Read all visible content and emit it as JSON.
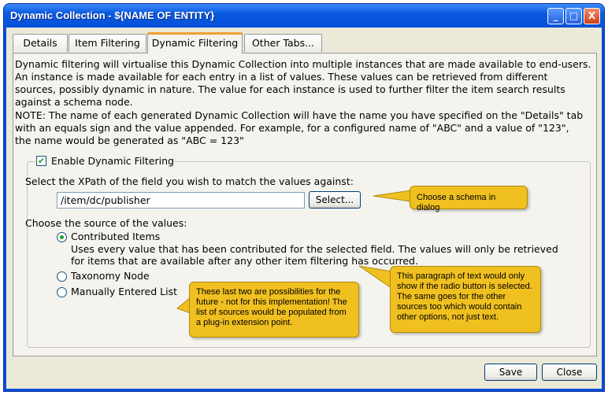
{
  "window": {
    "title": "Dynamic Collection - ${NAME OF ENTITY}",
    "minimize": "_",
    "maximize": "□",
    "close": "X"
  },
  "tabs": [
    {
      "label": "Details"
    },
    {
      "label": "Item Filtering"
    },
    {
      "label": "Dynamic Filtering"
    },
    {
      "label": "Other Tabs..."
    }
  ],
  "intro": [
    "Dynamic filtering will virtualise this Dynamic Collection into multiple instances that are made available to end-users.",
    "An instance is made available for each entry in a list of values.   These values can be retrieved from different",
    "sources, possibly dynamic in nature.  The value for each instance is used to further filter the item search results",
    "against a schema node."
  ],
  "note": [
    "NOTE: The name of each generated Dynamic Collection will have the name you have specified on the \"Details\" tab",
    "with an equals sign and the value appended.  For example, for a configured name of \"ABC\" and a value of \"123\",",
    "the name would be generated as \"ABC = 123\""
  ],
  "enable": {
    "label": "Enable Dynamic Filtering",
    "checked": true,
    "check": "✔"
  },
  "xpath": {
    "label": "Select the XPath of the field you wish to match the values against:",
    "value": "/item/dc/publisher",
    "button": "Select..."
  },
  "source": {
    "label": "Choose the source of the values:",
    "options": [
      {
        "label": "Contributed Items",
        "selected": true
      },
      {
        "label": "Taxonomy Node",
        "selected": false
      },
      {
        "label": "Manually Entered List",
        "selected": false
      }
    ],
    "description": [
      "Uses every value that has been contributed for the selected field.  The values will only be retrieved",
      "for items that are available after any other item filtering has occurred."
    ]
  },
  "callouts": {
    "select": "Choose a schema in dialog",
    "paragraph": "This paragraph of text would only show if the radio button is selected.  The same goes for the other sources too which would contain other options, not just text.",
    "future": "These last two are possibilities for the future - not for this implementation!  The list of sources would be populated from a plug-in extension point."
  },
  "footer": {
    "save": "Save",
    "close": "Close"
  },
  "colors": {
    "callout": "#f0c020",
    "titlebar": "#0a5ae0",
    "active_tab": "#f0a030"
  }
}
